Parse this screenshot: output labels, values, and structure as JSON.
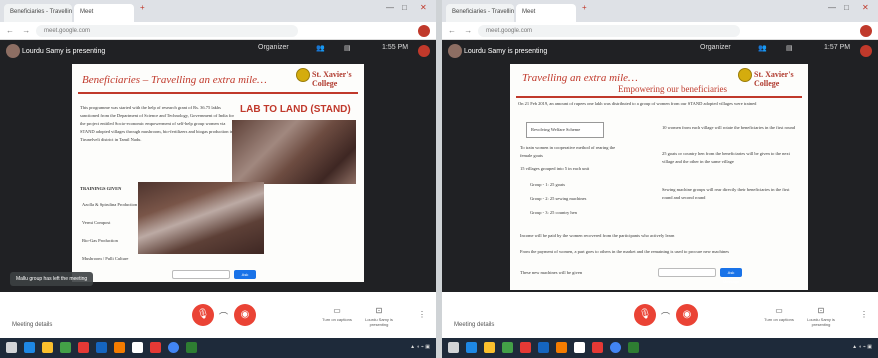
{
  "left": {
    "tabs": [
      "Beneficiaries - Travelling an extra mile",
      "Meet"
    ],
    "url": "meet.google.com",
    "presenter": "Lourdu Samy is presenting",
    "clock": "1:55 PM",
    "top_right_label": "Organizer",
    "slide": {
      "title": "Beneficiaries – Travelling an extra mile…",
      "college": "St. Xavier's College",
      "stand_label": "LAB TO LAND (STAND)",
      "paragraph": "This programme was started with the help of research grant of Rs. 36.75 lakhs sanctioned from the Department of Science and Technology, Government of India for the project entitled Socio-economic empowerment of self-help group women via STAND adopted villages through mushroom, bio-fertilizers and biogas production in Tirunelveli district in Tamil Nadu.",
      "trainings_heading": "TRAININGS GIVEN",
      "bullets": [
        "Azolla & Spirulina Production",
        "Vermi Compost",
        "Bio-Gas Production",
        "Mushroom / Pulli Culture"
      ],
      "send_label": "Ask Message"
    },
    "toast": "Mallu group has left the meeting",
    "meeting_details": "Meeting details",
    "captions_label": "Turn on captions",
    "presenting_label": "Lourdu Samy is presenting"
  },
  "right": {
    "tabs": [
      "Beneficiaries - Travelling an extra mile",
      "Meet"
    ],
    "url": "meet.google.com",
    "presenter": "Lourdu Samy is presenting",
    "clock": "1:57 PM",
    "top_right_label": "Organizer",
    "slide": {
      "title": "Travelling an extra mile…",
      "subtitle": "Empowering our beneficiaries",
      "college": "St. Xavier's College",
      "intro": "On 21 Feb 2019, an amount of rupees one lakh was distributed to a group of women from our STAND adopted villages were trained",
      "box_label": "Revolving Welfare Scheme",
      "left_bullets": [
        "To train women in cooperative method of rearing the female goats",
        "15 villages grouped into 5 in each unit",
        "Group - 1: 25 goats",
        "Group - 2: 25 sewing machines",
        "Group - 3: 25 country hen"
      ],
      "right_bullets": [
        "10 women from each village will rotate the beneficiaries in the first round",
        "25 goats or country hen from the beneficiaries will be given to the next village and the other in the same village",
        "Sewing machine groups will rear directly their beneficiaries in the first round and second round"
      ],
      "bottom_bullets": [
        "Income will be paid by the women recovered from the participants who actively learn",
        "From the payment of women, a part goes to others in the market and the remaining is used to procure new machines",
        "These new machines will be given"
      ],
      "send_label": "Ask Message"
    },
    "meeting_details": "Meeting details",
    "captions_label": "Turn on captions",
    "presenting_label": "Lourdu Samy is presenting"
  },
  "colors": {
    "slide_title": "#c0392b",
    "meet_bg": "#202124",
    "end_call": "#ea4335",
    "taskbar": "#1e2a3a"
  }
}
